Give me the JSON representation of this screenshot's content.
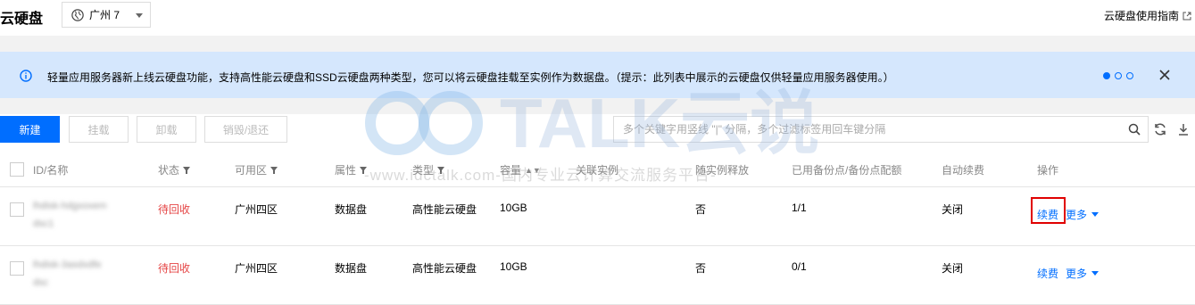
{
  "header": {
    "title": "云硬盘",
    "region": "广州 7",
    "guide_link": "云硬盘使用指南"
  },
  "notice": {
    "message": "轻量应用服务器新上线云硬盘功能，支持高性能云硬盘和SSD云硬盘两种类型，您可以将云硬盘挂载至实例作为数据盘。（提示：此列表中展示的云硬盘仅供轻量应用服务器使用。）"
  },
  "toolbar": {
    "new_label": "新建",
    "attach_label": "挂载",
    "detach_label": "卸载",
    "destroy_label": "销毁/退还",
    "search_placeholder": "多个关键字用竖线 \"|\" 分隔，多个过滤标签用回车键分隔"
  },
  "table": {
    "headers": {
      "id": "ID/名称",
      "status": "状态",
      "zone": "可用区",
      "attr": "属性",
      "type": "类型",
      "capacity": "容量",
      "instance": "关联实例",
      "release": "随实例释放",
      "backup": "已用备份点/备份点配额",
      "renew": "自动续费",
      "ops": "操作"
    },
    "rows": [
      {
        "id_line1": "lhdisk-hdgxoxem",
        "id_line2": "dsc1",
        "status": "待回收",
        "zone": "广州四区",
        "attr": "数据盘",
        "type": "高性能云硬盘",
        "capacity": "10GB",
        "instance": "",
        "release": "否",
        "backup": "1/1",
        "renew": "关闭",
        "op_renew": "续费",
        "op_more": "更多"
      },
      {
        "id_line1": "lhdisk-3asdxdfe",
        "id_line2": "dsc",
        "status": "待回收",
        "zone": "广州四区",
        "attr": "数据盘",
        "type": "高性能云硬盘",
        "capacity": "10GB",
        "instance": "",
        "release": "否",
        "backup": "0/1",
        "renew": "关闭",
        "op_renew": "续费",
        "op_more": "更多"
      }
    ]
  },
  "watermark": {
    "logo_text": "TALK云说",
    "subtitle": "-www.idctalk.com-国内专业云计算交流服务平台-"
  },
  "colors": {
    "brand": "#006eff",
    "status_red": "#e54545",
    "notice_bg": "#d5e7fd",
    "highlight": "#e00000"
  }
}
